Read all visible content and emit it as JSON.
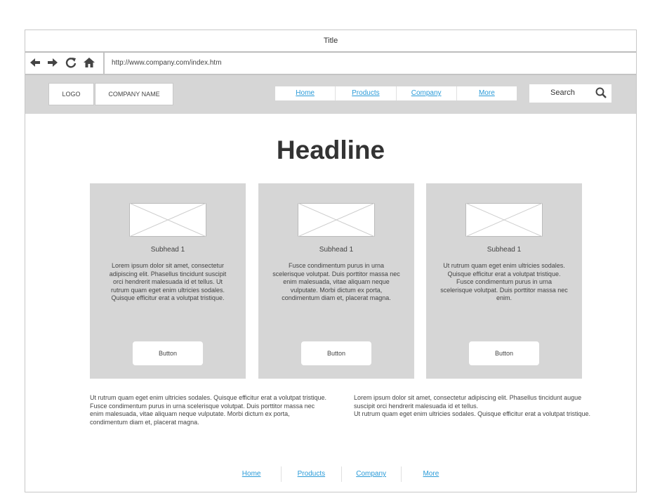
{
  "window": {
    "title": "Title"
  },
  "browser": {
    "nav_icons": [
      {
        "name": "back-arrow-icon",
        "glyph": "🡄"
      },
      {
        "name": "forward-arrow-icon",
        "glyph": "🡆"
      },
      {
        "name": "refresh-icon",
        "glyph": "⟳"
      },
      {
        "name": "home-icon",
        "glyph": "⌂"
      }
    ],
    "url": "http://www.company.com/index.htm"
  },
  "header": {
    "logo": "LOGO",
    "company_name": "COMPANY NAME",
    "nav": [
      "Home",
      "Products",
      "Company",
      "More"
    ],
    "search_label": "Search",
    "search_icon": "magnifier-icon"
  },
  "main": {
    "headline": "Headline",
    "cards": [
      {
        "subhead": "Subhead 1",
        "body": "Lorem ipsum dolor sit amet, consectetur adipiscing elit. Phasellus tincidunt suscipit orci hendrerit malesuada id et tellus. Ut rutrum quam eget enim ultricies sodales. Quisque efficitur erat a volutpat tristique.",
        "button": "Button"
      },
      {
        "subhead": "Subhead 1",
        "body": "Fusce condimentum purus in urna scelerisque volutpat. Duis porttitor massa nec enim malesuada, vitae aliquam neque vulputate. Morbi dictum ex porta, condimentum diam et, placerat magna.",
        "button": "Button"
      },
      {
        "subhead": "Subhead 1",
        "body": "Ut rutrum quam eget enim ultricies sodales. Quisque efficitur erat a volutpat tristique. Fusce condimentum purus in urna scelerisque volutpat. Duis porttitor massa nec enim.",
        "button": "Button"
      }
    ],
    "para_left": "Ut rutrum quam eget enim ultricies sodales. Quisque efficitur erat a volutpat tristique. Fusce condimentum purus in urna scelerisque volutpat. Duis porttitor massa nec enim malesuada, vitae aliquam neque vulputate. Morbi dictum ex porta, condimentum diam et, placerat magna.",
    "para_right": "Lorem ipsum dolor sit amet, consectetur adipiscing elit. Phasellus tincidunt augue suscipit orci hendrerit malesuada id et tellus.\nUt rutrum quam eget enim ultricies sodales. Quisque efficitur erat a volutpat tristique."
  },
  "footer": {
    "nav": [
      "Home",
      "Products",
      "Company",
      "More"
    ]
  },
  "colors": {
    "link": "#2b9bd8",
    "panel": "#d6d6d6",
    "border": "#c4c4c4"
  }
}
